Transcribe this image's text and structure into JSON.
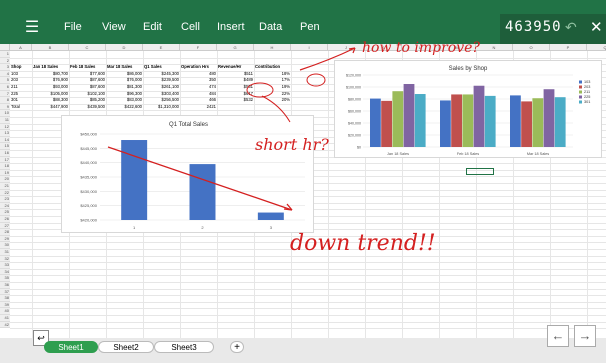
{
  "toolbar": {
    "menu": [
      "File",
      "View",
      "Edit",
      "Cell",
      "Insert",
      "Data",
      "Pen"
    ],
    "counter": "463950"
  },
  "sheet": {
    "columns": [
      "A",
      "B",
      "C",
      "D",
      "E",
      "F",
      "G",
      "H",
      "I",
      "J",
      "K",
      "L",
      "M",
      "N",
      "O",
      "P",
      "Q",
      "R"
    ],
    "header_row": [
      "Shop",
      "Jan 18 Sales",
      "Feb 18 Sales",
      "Mar 18 Sales",
      "Q1 Sales",
      "Operation Hrs",
      "Revenue/Hr",
      "Contribution"
    ],
    "rows": [
      [
        "103",
        "$80,700",
        "$77,600",
        "$86,000",
        "$245,300",
        "480",
        "$511",
        "18%"
      ],
      [
        "203",
        "$76,900",
        "$87,600",
        "$76,000",
        "$239,500",
        "350",
        "$489",
        "17%"
      ],
      [
        "211",
        "$93,000",
        "$87,600",
        "$81,300",
        "$261,100",
        "474",
        "$551",
        "19%"
      ],
      [
        "225",
        "$105,000",
        "$102,100",
        "$96,300",
        "$303,400",
        "484",
        "$617",
        "22%"
      ],
      [
        "301",
        "$88,300",
        "$85,200",
        "$83,000",
        "$256,500",
        "466",
        "$532",
        "20%"
      ],
      [
        "Total",
        "$447,900",
        "$439,500",
        "$422,600",
        "$1,310,000",
        "2421",
        "",
        ""
      ]
    ],
    "row_numbers": [
      "1",
      "2",
      "3",
      "4",
      "5",
      "6",
      "7",
      "8",
      "9",
      "10",
      "11",
      "12",
      "13",
      "14",
      "15",
      "16",
      "17",
      "18",
      "19",
      "20",
      "21",
      "22",
      "23",
      "24",
      "25",
      "26",
      "27",
      "28",
      "29",
      "30",
      "31",
      "32",
      "33",
      "34",
      "35",
      "36",
      "37",
      "38",
      "39",
      "40",
      "41",
      "42"
    ]
  },
  "chart_data": [
    {
      "type": "bar",
      "title": "Q1 Total Sales",
      "categories": [
        "1",
        "2",
        "3"
      ],
      "values": [
        447900,
        439500,
        422600
      ],
      "ylim": [
        420000,
        450000
      ],
      "yticks": [
        "$450,000",
        "$445,000",
        "$440,000",
        "$435,000",
        "$430,000",
        "$425,000",
        "$420,000"
      ],
      "color": "#4472c4"
    },
    {
      "type": "bar",
      "title": "Sales by Shop",
      "categories": [
        "Jan 18 Sales",
        "Feb 18 Sales",
        "Mar 18 Sales"
      ],
      "series": [
        {
          "name": "103",
          "values": [
            80700,
            77600,
            86000
          ],
          "color": "#4472c4"
        },
        {
          "name": "203",
          "values": [
            76900,
            87600,
            76000
          ],
          "color": "#c0504d"
        },
        {
          "name": "211",
          "values": [
            93000,
            87600,
            81300
          ],
          "color": "#9bbb59"
        },
        {
          "name": "225",
          "values": [
            105000,
            102100,
            96300
          ],
          "color": "#8064a2"
        },
        {
          "name": "301",
          "values": [
            88300,
            85200,
            83000
          ],
          "color": "#4bacc6"
        }
      ],
      "ylim": [
        0,
        120000
      ],
      "yticks": [
        "$120,000",
        "$100,000",
        "$80,000",
        "$60,000",
        "$40,000",
        "$20,000",
        "$0"
      ]
    }
  ],
  "annotations": {
    "how_to_improve": "how to improve?",
    "short_hr": "short hr?",
    "downtrend": "down trend!!"
  },
  "tabs": [
    "Sheet1",
    "Sheet2",
    "Sheet3"
  ],
  "icons": {
    "add_sheet": "plus-icon",
    "back": "arrow-left-icon",
    "forward": "arrow-right-icon",
    "exit": "exit-icon",
    "menu": "hamburger-icon",
    "undo": "undo-icon",
    "close": "close-icon"
  }
}
